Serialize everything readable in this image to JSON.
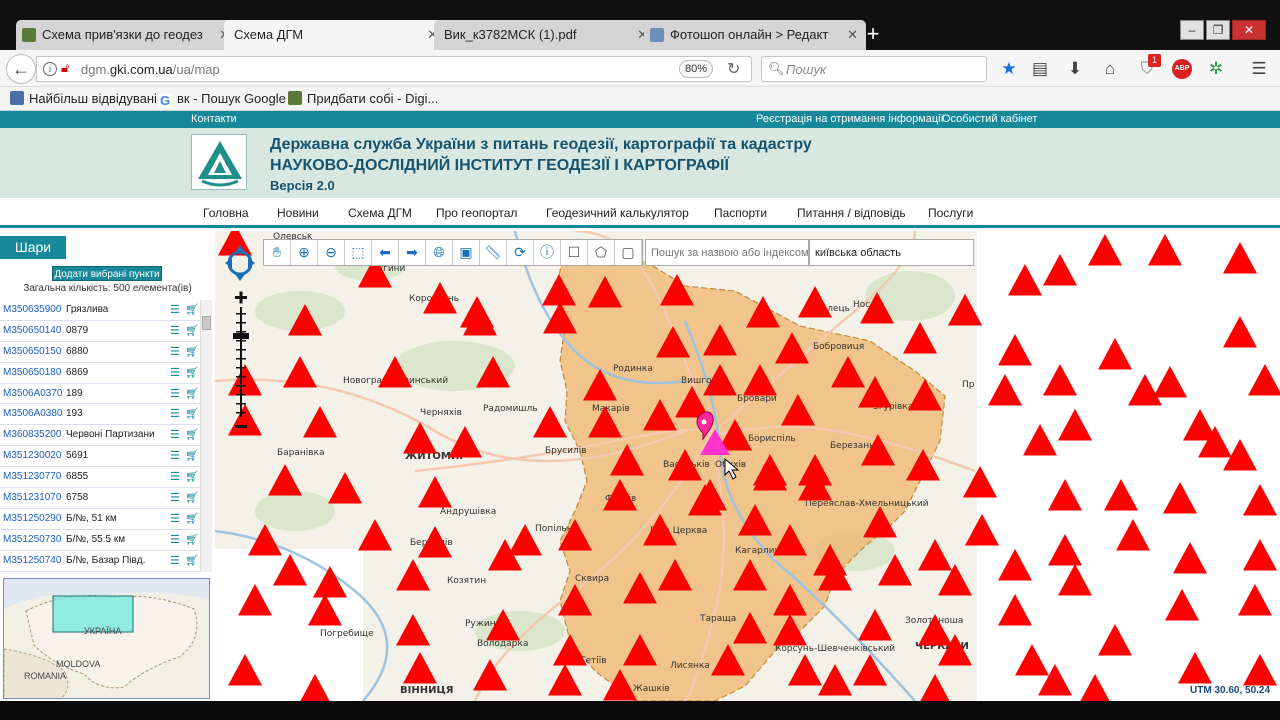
{
  "browser": {
    "tabs": [
      {
        "label": "Схема прив'язки до геодез",
        "active": false
      },
      {
        "label": "Схема ДГМ",
        "active": true
      },
      {
        "label": "Вик_к3782МСК (1).pdf",
        "active": false
      },
      {
        "label": "Фотошоп онлайн > Редакт",
        "active": false
      }
    ],
    "url_host_prefix": "dgm.",
    "url_host": "gki.com.ua",
    "url_path": "/ua/map",
    "zoom": "80%",
    "search_placeholder": "Пошук",
    "badge_count": "1",
    "abp_label": "ABP"
  },
  "bookmarks": [
    {
      "label": "Найбільш відвідувані"
    },
    {
      "label": "вк - Пошук Google"
    },
    {
      "label": "Придбати собі - Digi..."
    }
  ],
  "site": {
    "top_links": {
      "contacts": "Контакти",
      "register": "Реєстрація на отримання інформації",
      "cabinet": "Особистий кабінет"
    },
    "title1": "Державна служба України з питань геодезії, картографії та кадастру",
    "title2": "НАУКОВО-ДОСЛІДНИЙ ІНСТИТУТ ГЕОДЕЗІЇ І КАРТОГРАФІЇ",
    "version": "Версія 2.0",
    "menu": [
      "Головна",
      "Новини",
      "Схема ДГМ",
      "Про геопортал",
      "Геодезичний калькулятор",
      "Паспорти",
      "Питання / відповідь",
      "Послуги"
    ]
  },
  "sidebar": {
    "layers_label": "Шари",
    "add_label": "Додати вибрані пункти",
    "total": "Загальна кількість: 500 елемента(ів)",
    "points": [
      {
        "code": "M350635900",
        "name": "Грязлива"
      },
      {
        "code": "M350650140",
        "name": "0879"
      },
      {
        "code": "M350650150",
        "name": "6880"
      },
      {
        "code": "M350650180",
        "name": "6869"
      },
      {
        "code": "M3506A0370",
        "name": "189"
      },
      {
        "code": "M3506A0380",
        "name": "193"
      },
      {
        "code": "M360835200",
        "name": "Червоні Партизани"
      },
      {
        "code": "M351230020",
        "name": "5691"
      },
      {
        "code": "M351230770",
        "name": "6855"
      },
      {
        "code": "M351231070",
        "name": "6758"
      },
      {
        "code": "M351250290",
        "name": "Б/№, 51 км"
      },
      {
        "code": "M351250730",
        "name": "Б/№, 55.5 км"
      },
      {
        "code": "M351250740",
        "name": "Б/№, Базар Півд."
      }
    ],
    "minimap_labels": {
      "country": "УКРАЇНА",
      "moldova": "MOLDOVA",
      "romania": "ROMANIA"
    }
  },
  "map": {
    "search_placeholder": "Пошук за назвою або індексом",
    "region_value": "київська область",
    "utm": "UTM 30.60, 50.24",
    "colors": {
      "region": "#f0b46e",
      "marker": "#ff0000",
      "selected": "#ff33cc"
    },
    "places": [
      {
        "name": "Олевськ"
      },
      {
        "name": "Лугини"
      },
      {
        "name": "Коростень"
      },
      {
        "name": "Козелець"
      },
      {
        "name": "Бобровиця"
      },
      {
        "name": "Новоград-Волинський"
      },
      {
        "name": "Родинка"
      },
      {
        "name": "Вишгород"
      },
      {
        "name": "Бровари"
      },
      {
        "name": "Згурівка"
      },
      {
        "name": "Макарів"
      },
      {
        "name": "Черняхів"
      },
      {
        "name": "Радомишль"
      },
      {
        "name": "Бориспіль"
      },
      {
        "name": "Березань"
      },
      {
        "name": "Баранівка"
      },
      {
        "name": "ЖИТОМИР"
      },
      {
        "name": "Брусилів"
      },
      {
        "name": "Васильків"
      },
      {
        "name": "Обухів"
      },
      {
        "name": "Фастів"
      },
      {
        "name": "Переяслав-Хмельницький"
      },
      {
        "name": "Андрушівка"
      },
      {
        "name": "Попільня"
      },
      {
        "name": "Бердичів"
      },
      {
        "name": "Біла Церква"
      },
      {
        "name": "Кагарлик"
      },
      {
        "name": "Козятин"
      },
      {
        "name": "Сквира"
      },
      {
        "name": "Ружин"
      },
      {
        "name": "Тараща"
      },
      {
        "name": "Золотоноша"
      },
      {
        "name": "Погребище"
      },
      {
        "name": "Володарка"
      },
      {
        "name": "Тетіїв"
      },
      {
        "name": "Корсунь-Шевченківський"
      },
      {
        "name": "Лисянка"
      },
      {
        "name": "ЧЕРКАСИ"
      },
      {
        "name": "ВІННИЦЯ"
      },
      {
        "name": "Жашків"
      },
      {
        "name": "Нос"
      },
      {
        "name": "Пр"
      }
    ]
  }
}
